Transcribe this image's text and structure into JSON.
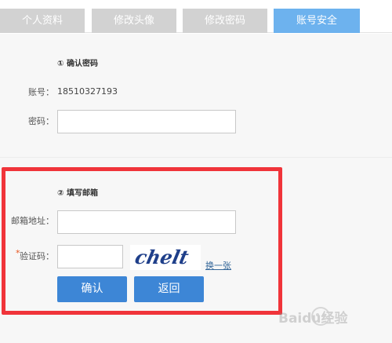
{
  "tabs": [
    {
      "label": "个人资料"
    },
    {
      "label": "修改头像"
    },
    {
      "label": "修改密码"
    },
    {
      "label": "账号安全"
    }
  ],
  "step1": {
    "title": "① 确认密码",
    "account_label": "账号：",
    "account_value": "18510327193",
    "password_label": "密码：",
    "password_value": ""
  },
  "step2": {
    "title": "② 填写邮箱",
    "email_label": "邮箱地址：",
    "email_value": "",
    "required_mark": "*",
    "captcha_label": "验证码：",
    "captcha_value": "",
    "captcha_text": "chelt",
    "refresh_label": "换一张",
    "confirm_label": "确认",
    "back_label": "返回"
  },
  "watermark": {
    "text": "Baidu经验"
  },
  "colors": {
    "active_tab": "#6db2ee",
    "inactive_tab": "#d2d2d2",
    "button": "#3d86d6",
    "highlight_border": "#f0343a",
    "required": "#e8551f"
  }
}
